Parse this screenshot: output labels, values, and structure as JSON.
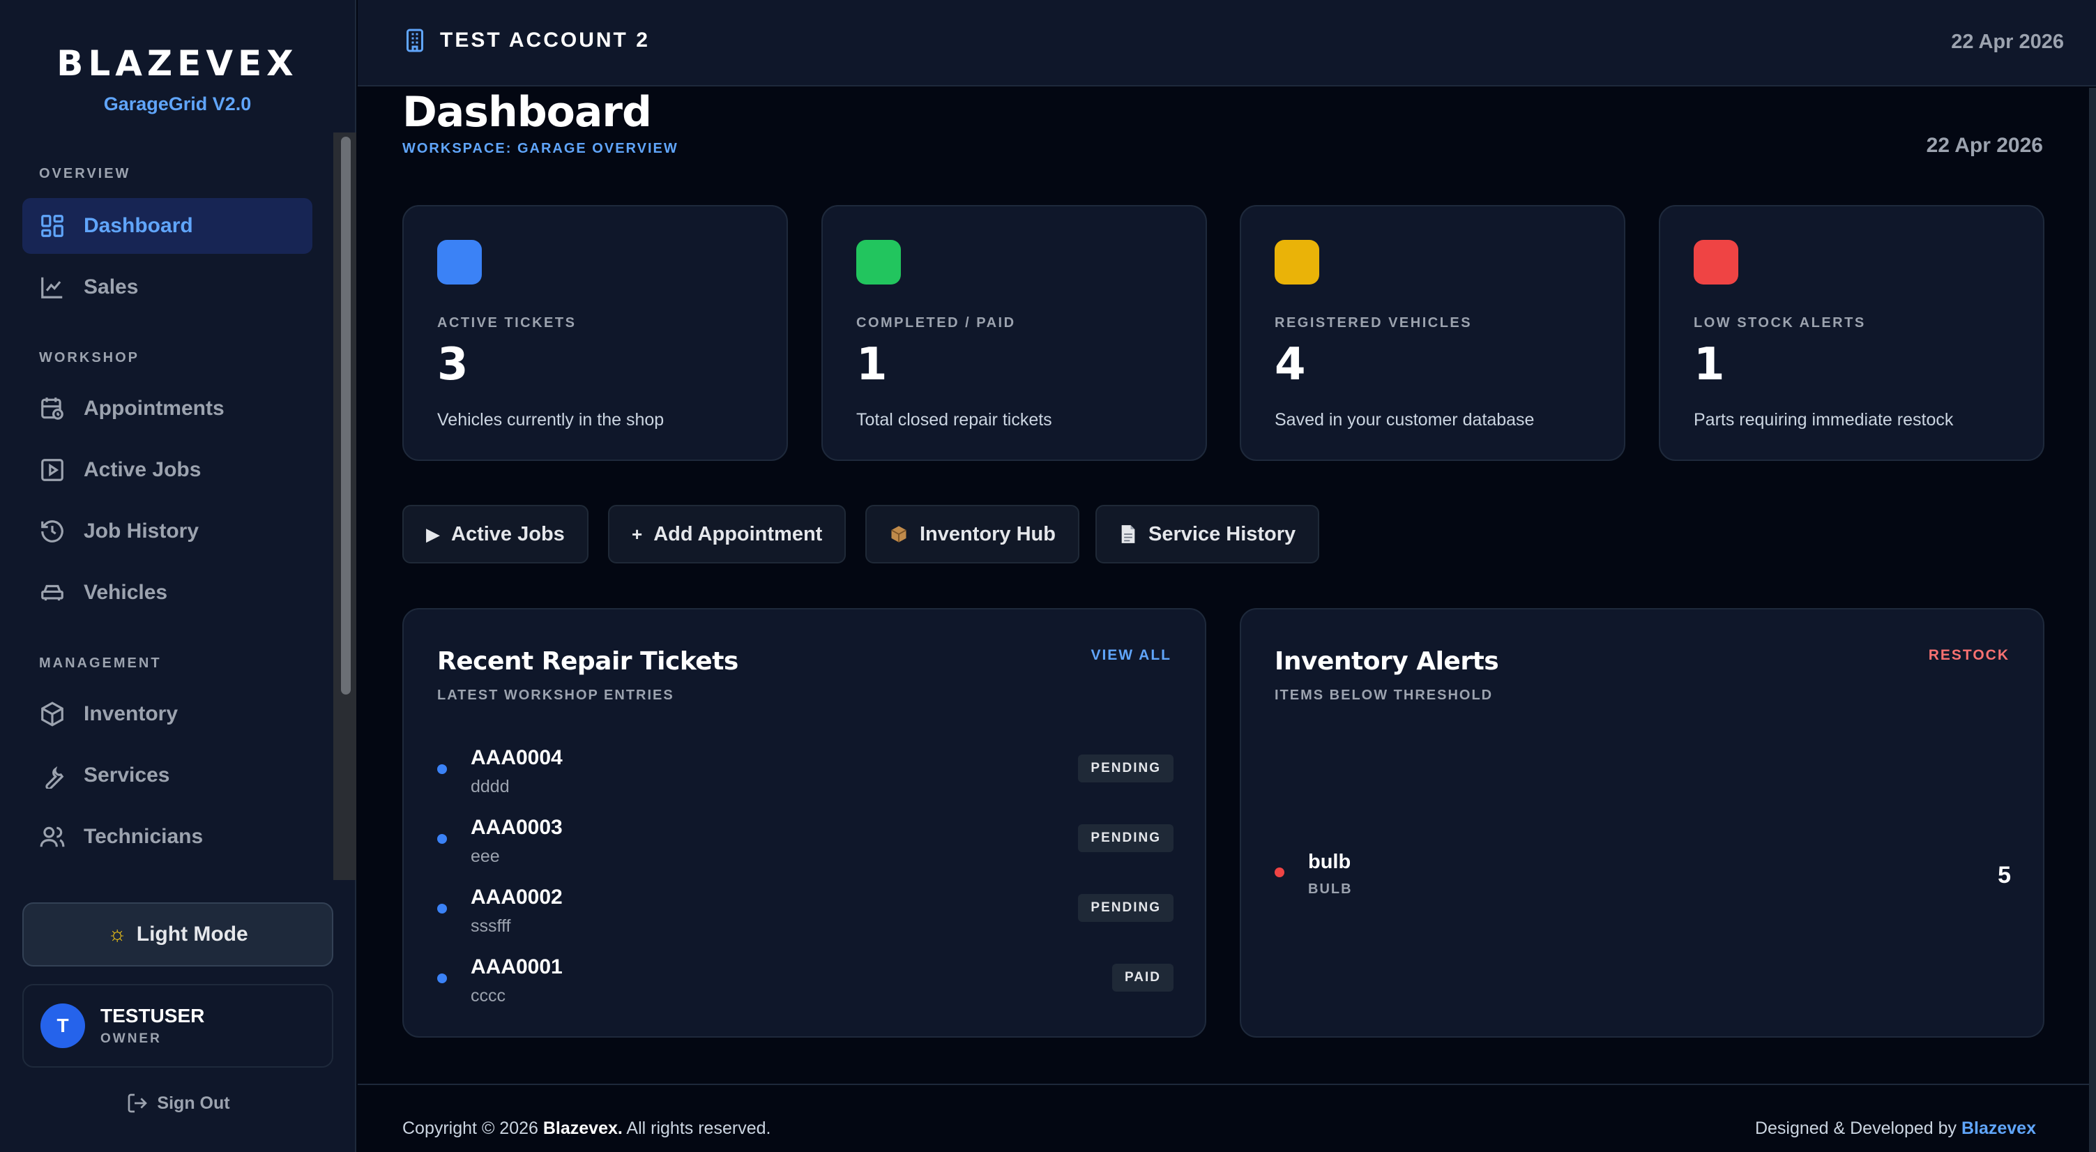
{
  "sidebar": {
    "brand": "BLAZEVEX",
    "version": "GarageGrid V2.0",
    "sections": {
      "overview": "OVERVIEW",
      "workshop": "WORKSHOP",
      "management": "MANAGEMENT"
    },
    "items": [
      {
        "label": "Dashboard",
        "icon": "dashboard-icon",
        "active": true
      },
      {
        "label": "Sales",
        "icon": "chart-icon"
      },
      {
        "label": "Appointments",
        "icon": "calendar-clock-icon"
      },
      {
        "label": "Active Jobs",
        "icon": "play-square-icon"
      },
      {
        "label": "Job History",
        "icon": "history-icon"
      },
      {
        "label": "Vehicles",
        "icon": "car-icon"
      },
      {
        "label": "Inventory",
        "icon": "box-icon"
      },
      {
        "label": "Services",
        "icon": "wrench-icon"
      },
      {
        "label": "Technicians",
        "icon": "users-icon"
      }
    ],
    "theme_toggle": "Light Mode",
    "user": {
      "initial": "T",
      "name": "TESTUSER",
      "role": "OWNER"
    },
    "sign_out": "Sign Out"
  },
  "topbar": {
    "account": "TEST ACCOUNT 2",
    "date": "22 Apr 2026"
  },
  "page": {
    "title": "Dashboard",
    "subtitle": "WORKSPACE: GARAGE OVERVIEW",
    "date": "22 Apr 2026"
  },
  "stats": [
    {
      "label": "ACTIVE TICKETS",
      "value": "3",
      "desc": "Vehicles currently in the shop",
      "color": "#3b82f6"
    },
    {
      "label": "COMPLETED / PAID",
      "value": "1",
      "desc": "Total closed repair tickets",
      "color": "#22c55e"
    },
    {
      "label": "REGISTERED VEHICLES",
      "value": "4",
      "desc": "Saved in your customer database",
      "color": "#eab308"
    },
    {
      "label": "LOW STOCK ALERTS",
      "value": "1",
      "desc": "Parts requiring immediate restock",
      "color": "#ef4444"
    }
  ],
  "actions": [
    {
      "label": "Active Jobs",
      "icon": "play-icon"
    },
    {
      "label": "Add Appointment",
      "icon": "plus-icon"
    },
    {
      "label": "Inventory Hub",
      "icon": "package-icon"
    },
    {
      "label": "Service History",
      "icon": "document-icon"
    }
  ],
  "tickets_panel": {
    "title": "Recent Repair Tickets",
    "subtitle": "LATEST WORKSHOP ENTRIES",
    "link": "VIEW ALL",
    "rows": [
      {
        "id": "AAA0004",
        "desc": "dddd",
        "status": "PENDING"
      },
      {
        "id": "AAA0003",
        "desc": "eee",
        "status": "PENDING"
      },
      {
        "id": "AAA0002",
        "desc": "sssfff",
        "status": "PENDING"
      },
      {
        "id": "AAA0001",
        "desc": "cccc",
        "status": "PAID"
      }
    ]
  },
  "inventory_panel": {
    "title": "Inventory Alerts",
    "subtitle": "ITEMS BELOW THRESHOLD",
    "link": "RESTOCK",
    "rows": [
      {
        "name": "bulb",
        "sku": "BULB",
        "qty": "5"
      }
    ]
  },
  "footer": {
    "copyright_prefix": "Copyright © 2026",
    "company": "Blazevex.",
    "rights": "All rights reserved.",
    "designed_prefix": "Designed & Developed by",
    "designer": "Blazevex"
  },
  "colors": {
    "accent": "#60a5fa",
    "danger": "#f87171",
    "background": "#030712",
    "panel": "#0f172a"
  }
}
